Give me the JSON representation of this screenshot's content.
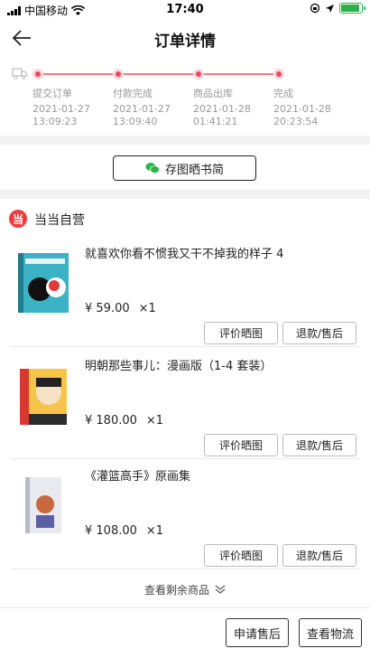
{
  "status_bar": {
    "carrier": "中国移动",
    "time": "17:40"
  },
  "nav": {
    "title": "订单详情"
  },
  "progress": {
    "steps": [
      {
        "label": "提交订单",
        "date": "2021-01-27",
        "time": "13:09:23"
      },
      {
        "label": "付款完成",
        "date": "2021-01-27",
        "time": "13:09:40"
      },
      {
        "label": "商品出库",
        "date": "2021-01-28",
        "time": "01:41:21"
      },
      {
        "label": "完成",
        "date": "2021-01-28",
        "time": "20:23:54"
      }
    ]
  },
  "save_button": {
    "label": "存图晒书简"
  },
  "shop": {
    "logo_char": "当",
    "name": "当当自营"
  },
  "items": [
    {
      "title": "就喜欢你看不惯我又干不掉我的样子 4",
      "price": "¥ 59.00",
      "qty": "×1",
      "review_label": "评价晒图",
      "refund_label": "退款/售后"
    },
    {
      "title": "明朝那些事儿：漫画版（1-4 套装）",
      "price": "¥ 180.00",
      "qty": "×1",
      "review_label": "评价晒图",
      "refund_label": "退款/售后"
    },
    {
      "title": "《灌篮高手》原画集",
      "price": "¥ 108.00",
      "qty": "×1",
      "review_label": "评价晒图",
      "refund_label": "退款/售后"
    }
  ],
  "more": {
    "label": "查看剩余商品"
  },
  "bottom": {
    "after_sale_label": "申请售后",
    "logistics_label": "查看物流"
  },
  "colors": {
    "accent": "#f0475e",
    "shop_logo": "#ef3b3b",
    "wechat": "#2ab34a",
    "battery": "#2ab34a"
  }
}
